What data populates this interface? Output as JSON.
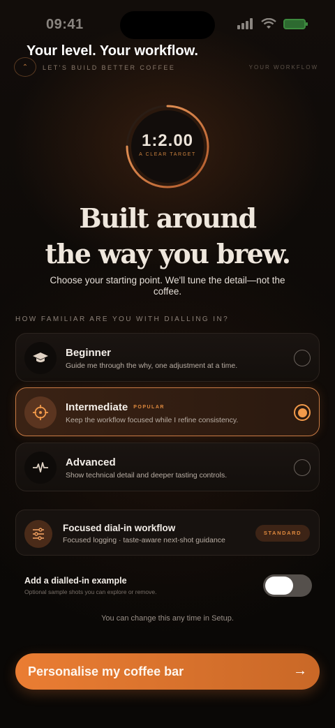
{
  "status_bar": {
    "time": "09:41"
  },
  "header": {
    "overlay_title": "Your level. Your workflow.",
    "kicker": "LET'S BUILD BETTER COFFEE",
    "step_label": "YOUR WORKFLOW"
  },
  "ring": {
    "value": "1:2.00",
    "caption": "A CLEAR TARGET",
    "progress_fraction": 0.75
  },
  "hero": {
    "headline_line1": "Built around",
    "headline_line2": "the way you brew.",
    "subcopy": "Choose your starting point. We'll tune the detail—not the coffee."
  },
  "question": "HOW FAMILIAR ARE YOU WITH DIALLING IN?",
  "levels": [
    {
      "title": "Beginner",
      "description": "Guide me through the why, one adjustment at a time.",
      "icon": "graduation-cap-icon",
      "selected": false
    },
    {
      "title": "Intermediate",
      "badge": "POPULAR",
      "description": "Keep the workflow focused while I refine consistency.",
      "icon": "crosshair-icon",
      "selected": true
    },
    {
      "title": "Advanced",
      "description": "Show technical detail and deeper tasting controls.",
      "icon": "pulse-icon",
      "selected": false
    }
  ],
  "workflow": {
    "title": "Focused dial-in workflow",
    "description": "Focused logging · taste-aware next-shot guidance",
    "badge": "STANDARD",
    "icon": "sliders-icon"
  },
  "example": {
    "title": "Add a dialled-in example",
    "subtitle": "Optional sample shots you can explore or remove.",
    "enabled": false
  },
  "footnote": "You can change this any time in Setup.",
  "cta": {
    "label": "Personalise my coffee bar",
    "icon": "arrow-right-icon"
  },
  "colors": {
    "accent": "#ea7d33",
    "background": "#0d0a08",
    "selected_border": "#c87a44"
  }
}
